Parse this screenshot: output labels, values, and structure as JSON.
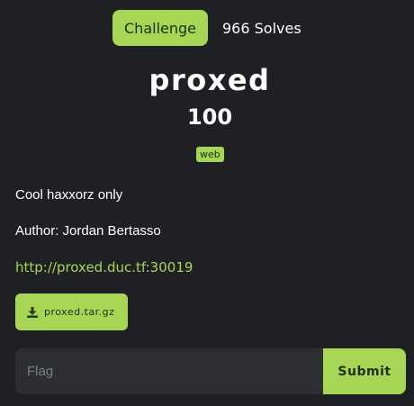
{
  "tabs": {
    "challenge_label": "Challenge",
    "solves_label": "966 Solves"
  },
  "challenge": {
    "name": "proxed",
    "points": "100",
    "tag": "web",
    "description_line1": "Cool haxxorz only",
    "description_line2": "Author: Jordan Bertasso",
    "link": "http://proxed.duc.tf:30019"
  },
  "download": {
    "icon": "download-icon",
    "file_name": "proxed.tar.gz"
  },
  "flag_form": {
    "placeholder": "Flag",
    "value": "",
    "submit_label": "Submit"
  },
  "colors": {
    "accent": "#a6d654",
    "background": "#1e2023",
    "input_background": "#2c2e31"
  }
}
